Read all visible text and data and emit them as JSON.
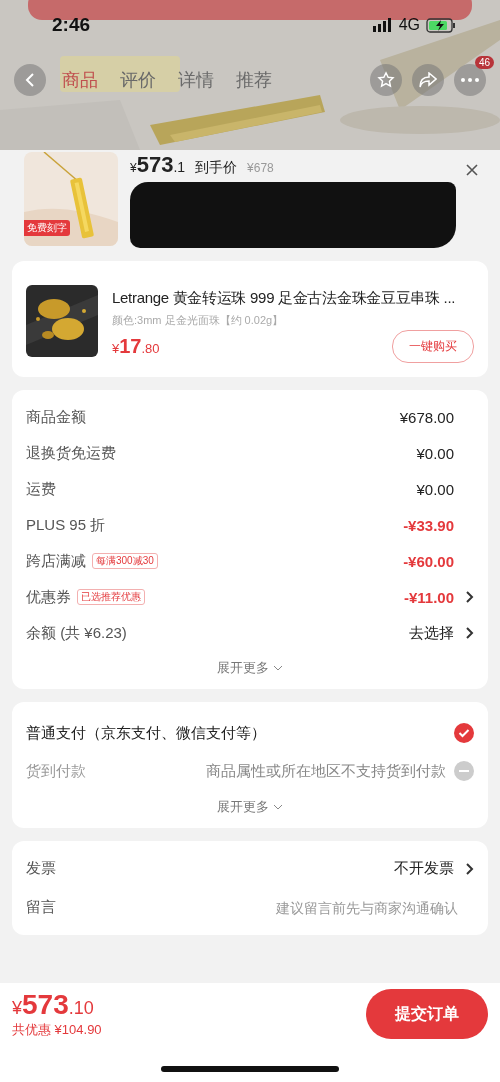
{
  "status_bar": {
    "time": "2:46",
    "network": "4G"
  },
  "nav": {
    "tabs": [
      {
        "label": "商品",
        "selected": true
      },
      {
        "label": "评价",
        "selected": false
      },
      {
        "label": "详情",
        "selected": false
      },
      {
        "label": "推荐",
        "selected": false
      }
    ],
    "badge": "46"
  },
  "sheet": {
    "currency": "¥",
    "price_int": "573",
    "price_dec": ".1",
    "price_label": "到手价",
    "original_price": "¥678",
    "thumb_badge": "免费刻字"
  },
  "addon": {
    "title": "Letrange 黄金转运珠 999 足金古法金珠金豆豆串珠 ...",
    "spec": "颜色:3mm 足金光面珠【约 0.02g】",
    "currency": "¥",
    "price_int": "17",
    "price_dec": ".80",
    "button": "一键购买"
  },
  "fees": [
    {
      "label": "商品金额",
      "value": "¥678.00",
      "highlighted": false,
      "chevron": false
    },
    {
      "label": "退换货免运费",
      "value": "¥0.00",
      "highlighted": false,
      "chevron": false
    },
    {
      "label": "运费",
      "value": "¥0.00",
      "highlighted": false,
      "chevron": false
    },
    {
      "label": "PLUS 95 折",
      "value": "-¥33.90",
      "highlighted": true,
      "chevron": false
    },
    {
      "label": "跨店满减",
      "tag": "每满300减30",
      "value": "-¥60.00",
      "highlighted": true,
      "chevron": false
    },
    {
      "label": "优惠券",
      "tag": "已选推荐优惠",
      "value": "-¥11.00",
      "highlighted": true,
      "chevron": true
    },
    {
      "label": "余额 (共 ¥6.23)",
      "value": "去选择",
      "highlighted": false,
      "chevron": true
    }
  ],
  "fees_more": "展开更多",
  "payments": [
    {
      "label": "普通支付（京东支付、微信支付等）",
      "selected": true,
      "disabled": false
    },
    {
      "label": "货到付款",
      "note": "商品属性或所在地区不支持货到付款",
      "selected": false,
      "disabled": true
    }
  ],
  "payments_more": "展开更多",
  "extras": [
    {
      "label": "发票",
      "value": "不开发票",
      "chevron": true
    },
    {
      "label": "留言",
      "placeholder": "建议留言前先与商家沟通确认"
    }
  ],
  "footer": {
    "currency": "¥",
    "total_int": "573",
    "total_dec": ".10",
    "discount": "共优惠 ¥104.90",
    "submit": "提交订单"
  }
}
